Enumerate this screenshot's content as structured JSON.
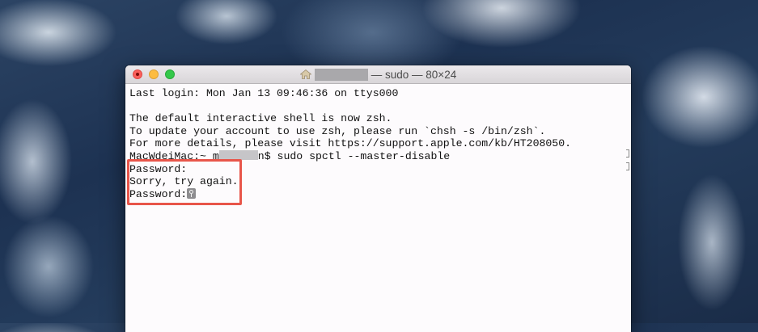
{
  "window": {
    "title": "— sudo — 80×24"
  },
  "terminal": {
    "lines": [
      "Last login: Mon Jan 13 09:46:36 on ttys000",
      "",
      "The default interactive shell is now zsh.",
      "To update your account to use zsh, please run `chsh -s /bin/zsh`.",
      "For more details, please visit https://support.apple.com/kb/HT208050."
    ],
    "prompt_prefix": "MacWdeiMac:~ m",
    "prompt_suffix": "n$ sudo spctl --master-disable",
    "password_line_1": "Password:",
    "sorry_line": "Sorry, try again.",
    "password_line_2": "Password:"
  },
  "colors": {
    "highlight": "#e8554a",
    "close": "#fc605c",
    "minimize": "#fdbc40",
    "maximize": "#34c84a"
  },
  "icons": {
    "home": "home-icon",
    "password_cursor": "key-cursor-icon"
  }
}
